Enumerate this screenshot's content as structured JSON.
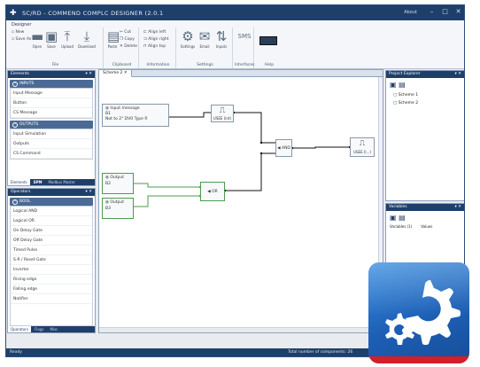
{
  "window": {
    "title": "SC/RD - COMMEND COMPLC DESIGNER (2.0.1",
    "help_label": "About",
    "controls": [
      "minimize-icon",
      "maximize-icon",
      "close-icon"
    ]
  },
  "ribbon": {
    "tab_label": "Designer",
    "groups": [
      {
        "label": "File",
        "items": [
          {
            "label": "New",
            "icon": "new-file-icon"
          },
          {
            "label": "Open",
            "icon": "folder-icon"
          },
          {
            "label": "Save",
            "icon": "save-icon"
          },
          {
            "label": "Upload",
            "icon": "upload-icon"
          },
          {
            "label": "Download",
            "icon": "download-icon"
          }
        ],
        "small": [
          "New",
          "Save As"
        ]
      },
      {
        "label": "Clipboard",
        "items": [
          {
            "label": "Paste",
            "icon": "paste-icon"
          }
        ],
        "small": [
          "Cut",
          "Copy",
          "Delete"
        ]
      },
      {
        "label": "Information",
        "items": [],
        "small": [
          "Align left",
          "Align right",
          "Align top"
        ]
      },
      {
        "label": "Settings",
        "items": [
          {
            "label": "Settings",
            "icon": "gear-icon"
          },
          {
            "label": "Email",
            "icon": "envelope-icon"
          },
          {
            "label": "Inputs",
            "icon": "io-icon"
          }
        ],
        "small": []
      },
      {
        "label": "Interfaces",
        "items": [
          {
            "label": "SMS",
            "icon": "sms-icon"
          }
        ],
        "small": []
      },
      {
        "label": "Help",
        "items": [
          {
            "label": "",
            "icon": "battery-icon"
          }
        ],
        "small": []
      }
    ]
  },
  "left_pane": {
    "title": "Elements",
    "sections": [
      {
        "label": "INPUTS",
        "items": [
          "Input Message",
          "Button",
          "CS Message"
        ]
      },
      {
        "label": "OUTPUTS",
        "items": [
          "Input Simulation",
          "Outputs",
          "CS Command"
        ]
      }
    ],
    "tabs": [
      "Elements",
      "SPM",
      "Modbus Master"
    ]
  },
  "operators_pane": {
    "title": "Operators",
    "section": "BOOL",
    "items": [
      "Logical AND",
      "Logical OR",
      "On Delay Gate",
      "Off Delay Gate",
      "Timed Pulse",
      "S-R / Reset Gate",
      "Inverter",
      "Rising edge",
      "Falling edge",
      "Notifier"
    ],
    "tabs": [
      "Operators",
      "Flags",
      "Misc"
    ]
  },
  "document": {
    "tab_label": "Scheme 2"
  },
  "canvas_nodes": {
    "input_message": {
      "title": "Input message",
      "line1": "B1",
      "line2": "Not to 2° DV0 Type R"
    },
    "block_top": {
      "caption": "USEE (int)"
    },
    "and_gate": {
      "label": "AND"
    },
    "output_block": {
      "caption": "USEE (l...)"
    },
    "output1": {
      "title": "Output",
      "value": "B2"
    },
    "output2": {
      "title": "Output",
      "value": "B3"
    },
    "or_gate": {
      "label": "OR"
    }
  },
  "explorer_pane": {
    "title": "Project Explorer",
    "items": [
      "Scheme 1",
      "Scheme 2"
    ]
  },
  "variables_pane": {
    "title": "Variables",
    "columns": [
      "Variables (1)",
      "Values"
    ]
  },
  "statusbar": {
    "left": "Ready",
    "right": "Total number of components: 26"
  },
  "colors": {
    "frame": "#1f3f6b",
    "badge": "#2a78cf",
    "badge_strip": "#d21f2a",
    "green_link": "#4f9a4f"
  }
}
